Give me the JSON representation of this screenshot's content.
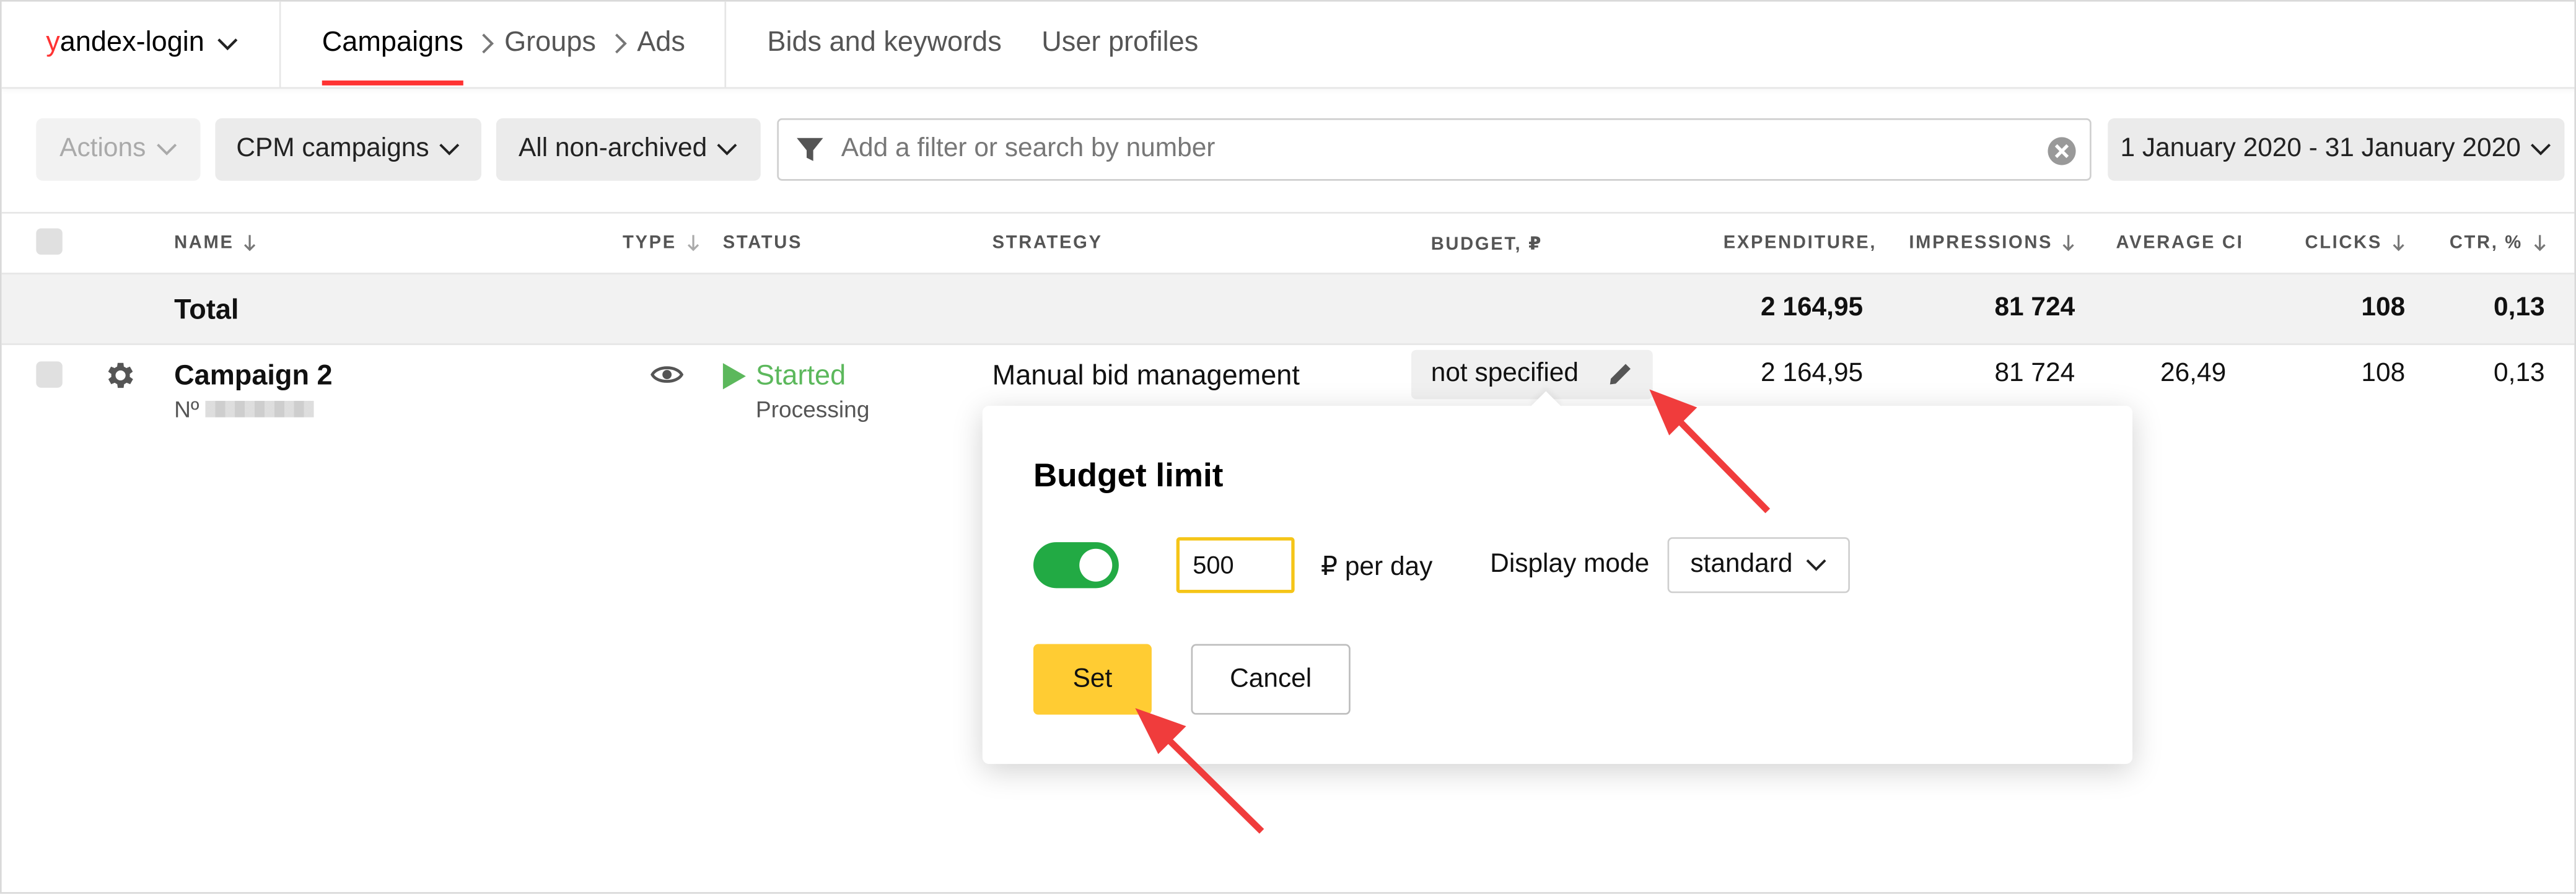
{
  "header": {
    "login_prefix": "y",
    "login_rest": "andex-login",
    "breadcrumbs": [
      "Campaigns",
      "Groups",
      "Ads"
    ],
    "links": [
      "Bids and keywords",
      "User profiles"
    ]
  },
  "toolbar": {
    "actions_label": "Actions",
    "campaign_type": "CPM campaigns",
    "archive_filter": "All non-archived",
    "search_placeholder": "Add a filter or search by number",
    "date_range": "1 January 2020 - 31 January 2020"
  },
  "table": {
    "columns": {
      "name": "NAME",
      "type": "TYPE",
      "status": "STATUS",
      "strategy": "STRATEGY",
      "budget": "BUDGET, ₽",
      "expenditure": "EXPENDITURE,",
      "impressions": "IMPRESSIONS",
      "average_cpc": "AVERAGE CP",
      "clicks": "CLICKS",
      "ctr": "CTR, %"
    },
    "total": {
      "label": "Total",
      "expenditure": "2 164,95",
      "impressions": "81 724",
      "clicks": "108",
      "ctr": "0,13"
    },
    "rows": [
      {
        "name": "Campaign 2",
        "number_label": "Nº",
        "status": "Started",
        "status_sub": "Processing",
        "strategy": "Manual bid management",
        "budget": "not specified",
        "expenditure": "2 164,95",
        "impressions": "81 724",
        "average_cpc": "26,49",
        "clicks": "108",
        "ctr": "0,13"
      }
    ]
  },
  "popup": {
    "title": "Budget limit",
    "enabled": true,
    "amount": "500",
    "per_day_label": "₽ per day",
    "display_mode_label": "Display mode",
    "display_mode_value": "standard",
    "set_label": "Set",
    "cancel_label": "Cancel"
  },
  "colors": {
    "accent_red": "#ff3333",
    "started_green": "#5cb85c",
    "toggle_green": "#22aa44",
    "set_yellow": "#ffcc33",
    "annotation_arrow": "#f03c3c"
  }
}
